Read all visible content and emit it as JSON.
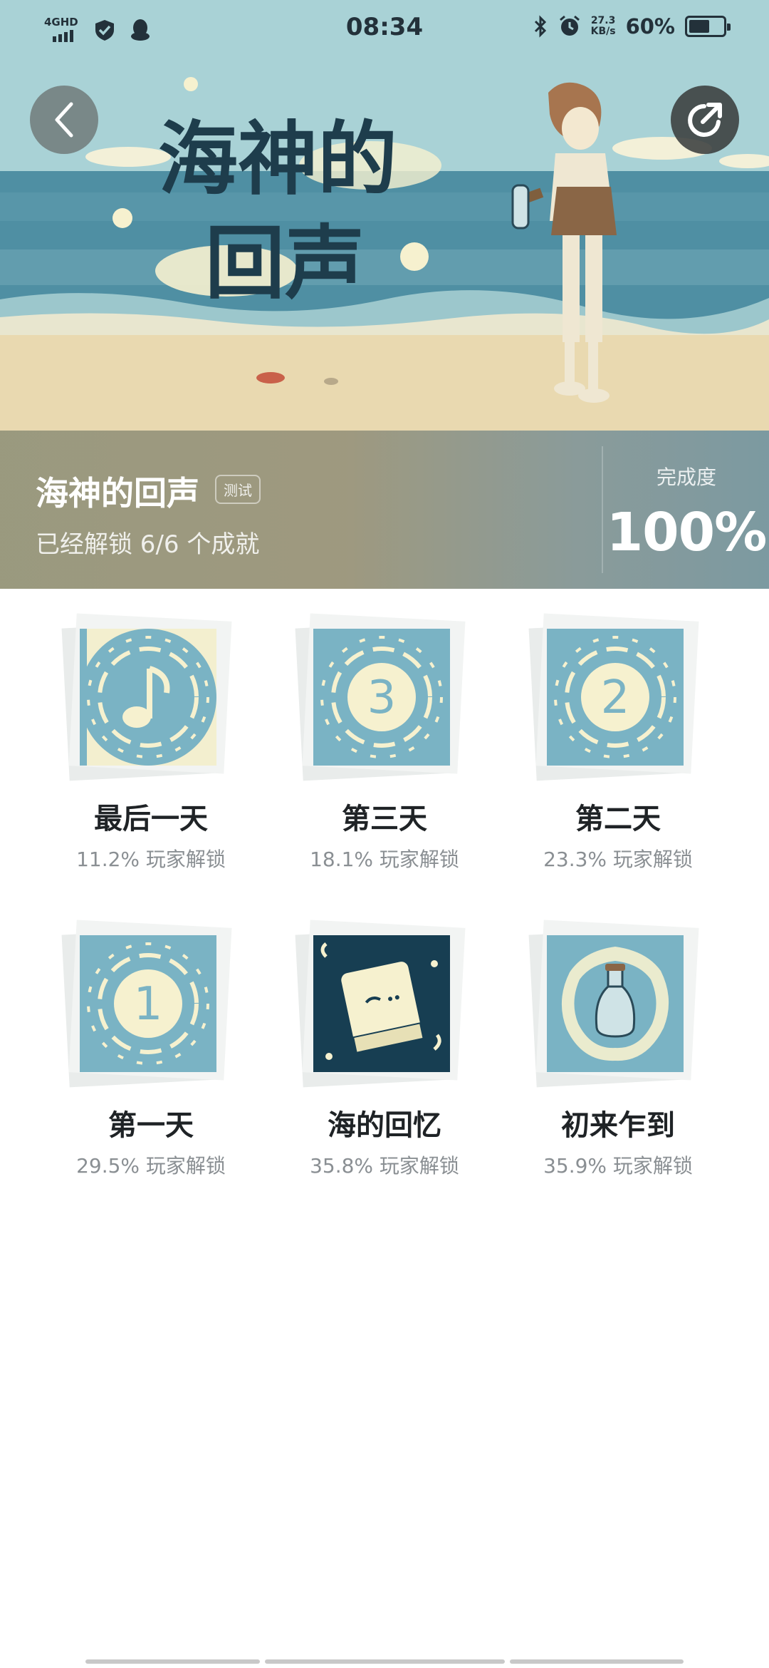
{
  "status_bar": {
    "network": "4GHD",
    "time": "08:34",
    "speed_value": "27.3",
    "speed_unit": "KB/s",
    "battery_percent": "60%",
    "battery_level": 0.6
  },
  "hero": {
    "game_title": "海神的回声",
    "test_badge": "测试",
    "unlock_summary": "已经解锁 6/6 个成就",
    "completion_label": "完成度",
    "completion_value": "100%",
    "art_caption_line1": "海神的",
    "art_caption_line2": "回声"
  },
  "icons": {
    "back": "chevron-left-icon",
    "share": "share-icon",
    "colors": {
      "tile": "#7ab3c4",
      "tile_dark": "#173e52",
      "cream": "#f6f1cf"
    }
  },
  "achievements": [
    {
      "name": "最后一天",
      "rate": "11.2% 玩家解锁",
      "icon": "music-note-icon"
    },
    {
      "name": "第三天",
      "rate": "18.1% 玩家解锁",
      "icon": "number-three-icon"
    },
    {
      "name": "第二天",
      "rate": "23.3% 玩家解锁",
      "icon": "number-two-icon"
    },
    {
      "name": "第一天",
      "rate": "29.5% 玩家解锁",
      "icon": "number-one-icon"
    },
    {
      "name": "海的回忆",
      "rate": "35.8% 玩家解锁",
      "icon": "book-icon"
    },
    {
      "name": "初来乍到",
      "rate": "35.9% 玩家解锁",
      "icon": "bottle-icon"
    }
  ]
}
